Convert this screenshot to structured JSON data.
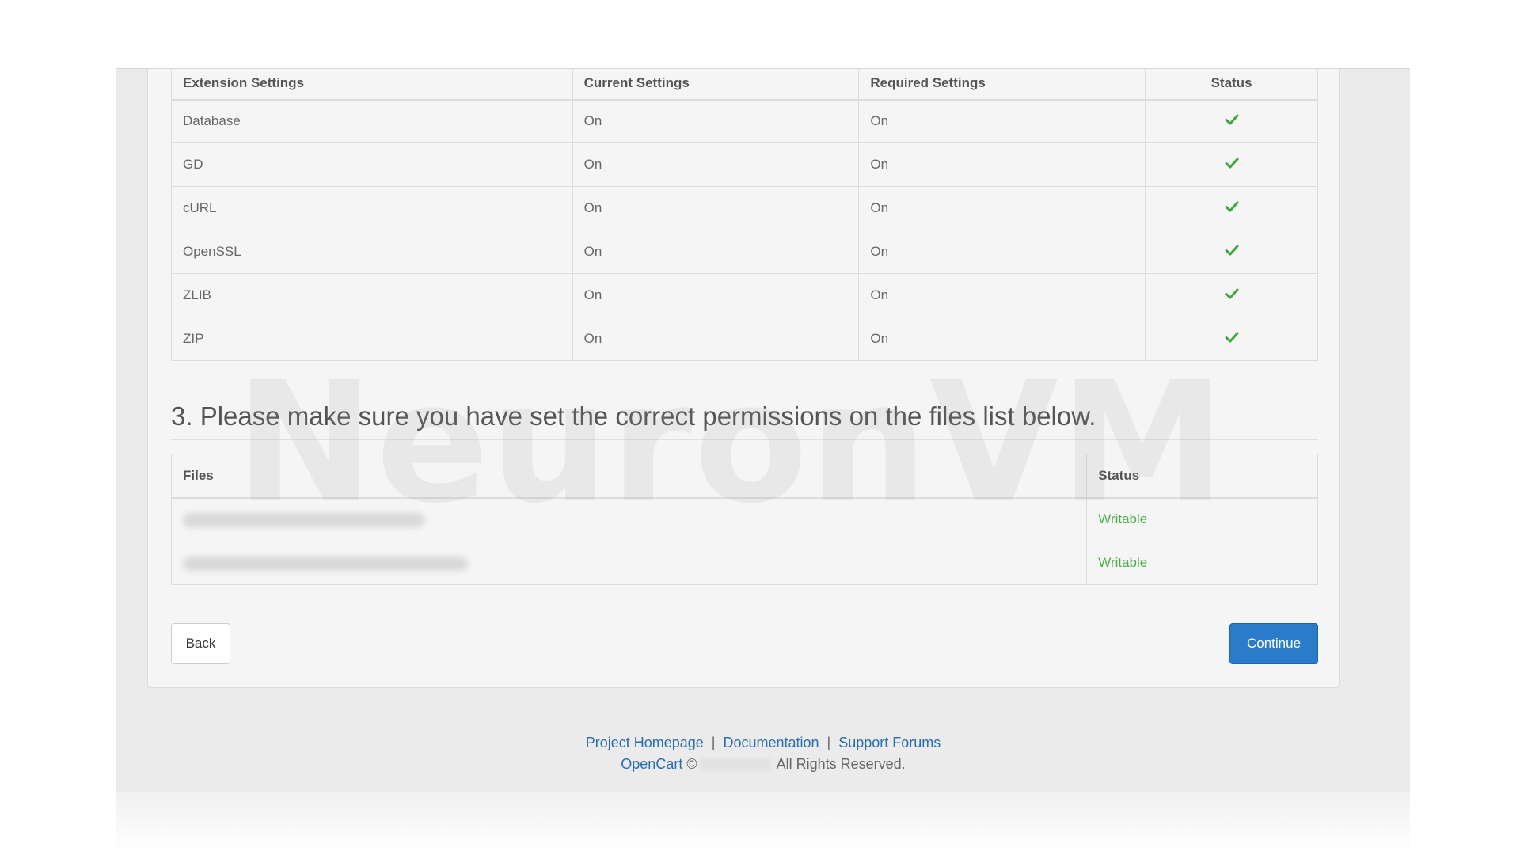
{
  "extensions": {
    "headers": [
      "Extension Settings",
      "Current Settings",
      "Required Settings",
      "Status"
    ],
    "rows": [
      {
        "name": "Database",
        "current": "On",
        "required": "On",
        "status": "ok"
      },
      {
        "name": "GD",
        "current": "On",
        "required": "On",
        "status": "ok"
      },
      {
        "name": "cURL",
        "current": "On",
        "required": "On",
        "status": "ok"
      },
      {
        "name": "OpenSSL",
        "current": "On",
        "required": "On",
        "status": "ok"
      },
      {
        "name": "ZLIB",
        "current": "On",
        "required": "On",
        "status": "ok"
      },
      {
        "name": "ZIP",
        "current": "On",
        "required": "On",
        "status": "ok"
      }
    ]
  },
  "permissions": {
    "title": "3. Please make sure you have set the correct permissions on the files list below.",
    "headers": [
      "Files",
      "Status"
    ],
    "rows": [
      {
        "file": "",
        "status": "Writable"
      },
      {
        "file": "",
        "status": "Writable"
      }
    ]
  },
  "buttons": {
    "back": "Back",
    "continue": "Continue"
  },
  "footer": {
    "links": [
      "Project Homepage",
      "Documentation",
      "Support Forums"
    ],
    "separator": "|",
    "brand": "OpenCart",
    "copyright_symbol": "©",
    "rights": "All Rights Reserved."
  },
  "watermark": "NeuronVM",
  "colors": {
    "check": "#3ca83c",
    "writable": "#4cae4c",
    "primary": "#2a7ccb",
    "link": "#2a6cb0"
  },
  "icons": {
    "status_ok": "check-icon"
  }
}
